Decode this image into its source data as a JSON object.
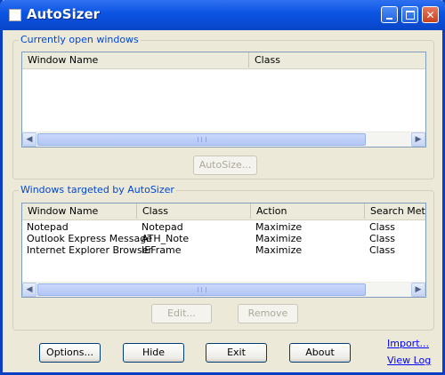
{
  "window": {
    "title": "AutoSizer"
  },
  "open_group": {
    "title": "Currently open windows",
    "columns": [
      "Window Name",
      "Class"
    ],
    "autosize_label": "AutoSize..."
  },
  "targeted_group": {
    "title": "Windows targeted by AutoSizer",
    "columns": [
      "Window Name",
      "Class",
      "Action",
      "Search Metho"
    ],
    "rows": [
      [
        "Notepad",
        "Notepad",
        "Maximize",
        "Class"
      ],
      [
        "Outlook Express Message",
        "ATH_Note",
        "Maximize",
        "Class"
      ],
      [
        "Internet Explorer Browser",
        "IEFrame",
        "Maximize",
        "Class"
      ]
    ],
    "edit_label": "Edit...",
    "remove_label": "Remove"
  },
  "footer": {
    "options_label": "Options...",
    "hide_label": "Hide",
    "exit_label": "Exit",
    "about_label": "About",
    "import_label": "Import...",
    "viewlog_label": "View Log"
  },
  "icons": {
    "scroll_left": "◀",
    "scroll_right": "▶"
  },
  "colors": {
    "titlebar": "#0a54e3",
    "group_title": "#0046d5",
    "window_bg": "#ece9d8"
  }
}
